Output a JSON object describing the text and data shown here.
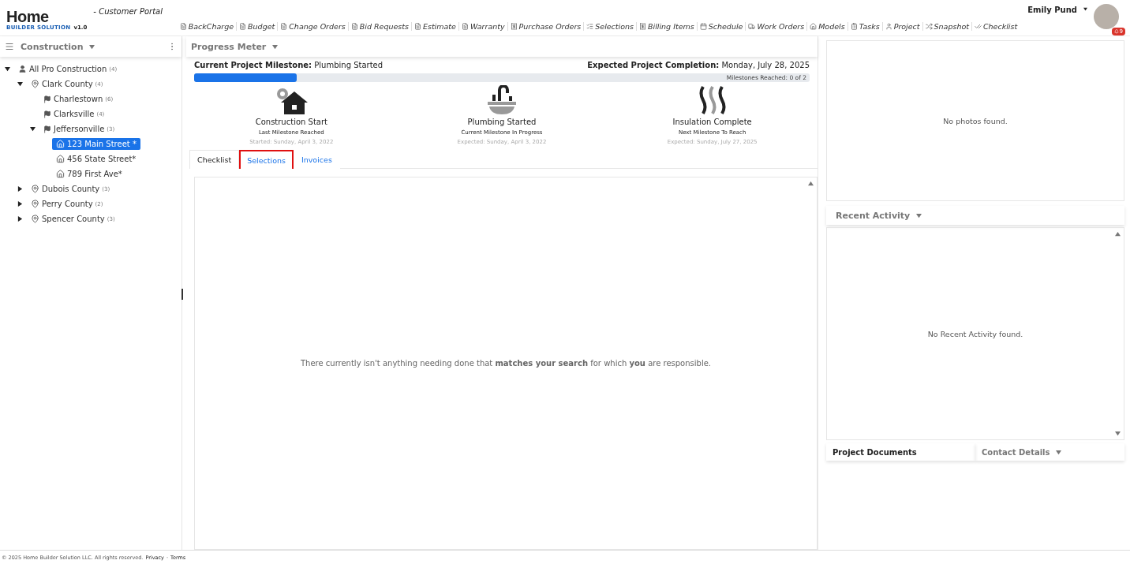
{
  "header": {
    "logo": {
      "word": "Home",
      "tagline": "BUILDER SOLUTION",
      "version": "v1.0"
    },
    "portal": "- Customer Portal",
    "nav": [
      {
        "label": "BackCharge"
      },
      {
        "label": "Budget"
      },
      {
        "label": "Change Orders"
      },
      {
        "label": "Bid Requests"
      },
      {
        "label": "Estimate"
      },
      {
        "label": "Warranty"
      },
      {
        "label": "Purchase Orders"
      },
      {
        "label": "Selections"
      },
      {
        "label": "Billing Items"
      },
      {
        "label": "Schedule"
      },
      {
        "label": "Work Orders"
      },
      {
        "label": "Models"
      },
      {
        "label": "Tasks"
      },
      {
        "label": "Project"
      },
      {
        "label": "Snapshot"
      },
      {
        "label": "Checklist"
      }
    ],
    "user": {
      "name": "Emily Pund",
      "notifications": "9"
    }
  },
  "sidebar": {
    "title": "Construction",
    "tree": [
      {
        "kind": "company",
        "label": "All Pro Construction",
        "count": "(4)",
        "expanded": true,
        "selected": false,
        "children": [
          {
            "kind": "county",
            "label": "Clark County",
            "count": "(4)",
            "expanded": true,
            "selected": false,
            "children": [
              {
                "kind": "city",
                "label": "Charlestown",
                "count": "(6)",
                "selected": false
              },
              {
                "kind": "city",
                "label": "Clarksville",
                "count": "(4)",
                "selected": false
              },
              {
                "kind": "city",
                "label": "Jeffersonville",
                "count": "(3)",
                "expanded": true,
                "selected": false,
                "children": [
                  {
                    "kind": "house",
                    "label": "123 Main Street *",
                    "selected": true
                  },
                  {
                    "kind": "house",
                    "label": "456 State Street*",
                    "selected": false
                  },
                  {
                    "kind": "house",
                    "label": "789 First Ave*",
                    "selected": false
                  }
                ]
              }
            ]
          },
          {
            "kind": "county",
            "label": "Dubois County",
            "count": "(3)",
            "expanded": false,
            "selected": false
          },
          {
            "kind": "county",
            "label": "Perry County",
            "count": "(2)",
            "expanded": false,
            "selected": false
          },
          {
            "kind": "county",
            "label": "Spencer County",
            "count": "(3)",
            "expanded": false,
            "selected": false
          }
        ]
      }
    ]
  },
  "progress": {
    "title": "Progress Meter",
    "milestone_label": "Current Project Milestone:",
    "milestone": "Plumbing Started",
    "completion_label": "Expected Project Completion:",
    "completion": "Monday, July 28, 2025",
    "level": 0.167,
    "reached": "Milestones Reached: 0 of 2",
    "milestones": [
      {
        "kind": "construction",
        "name": "Construction Start",
        "status": "Last Milestone Reached",
        "date": "Started: Sunday, April 3, 2022"
      },
      {
        "kind": "plumbing",
        "name": "Plumbing Started",
        "status": "Current Milestone In Progress",
        "date": "Expected: Sunday, April 3, 2022"
      },
      {
        "kind": "insulation",
        "name": "Insulation Complete",
        "status": "Next Milestone To Reach",
        "date": "Expected: Sunday, July 27, 2025"
      }
    ]
  },
  "tabs": [
    {
      "label": "Checklist",
      "selected": true,
      "highlighted": false
    },
    {
      "label": "Selections",
      "selected": false,
      "highlighted": true
    },
    {
      "label": "Invoices",
      "selected": false,
      "highlighted": false
    }
  ],
  "checklist": {
    "message": "There currently isn't anything needing done that **matches your search** for which **you** are responsible."
  },
  "photos": {
    "message": "No photos found."
  },
  "recent_activity": {
    "title": "Recent Activity",
    "message": "No Recent Activity found."
  },
  "bottom_panels": [
    {
      "title": "Project Documents",
      "dropdown": false
    },
    {
      "title": "Contact Details",
      "dropdown": true
    }
  ],
  "footer": {
    "text": "© 2025 Home Builder Solution LLC. All rights reserved.",
    "links": [
      "Privacy",
      "Terms"
    ],
    "separator": "·"
  }
}
